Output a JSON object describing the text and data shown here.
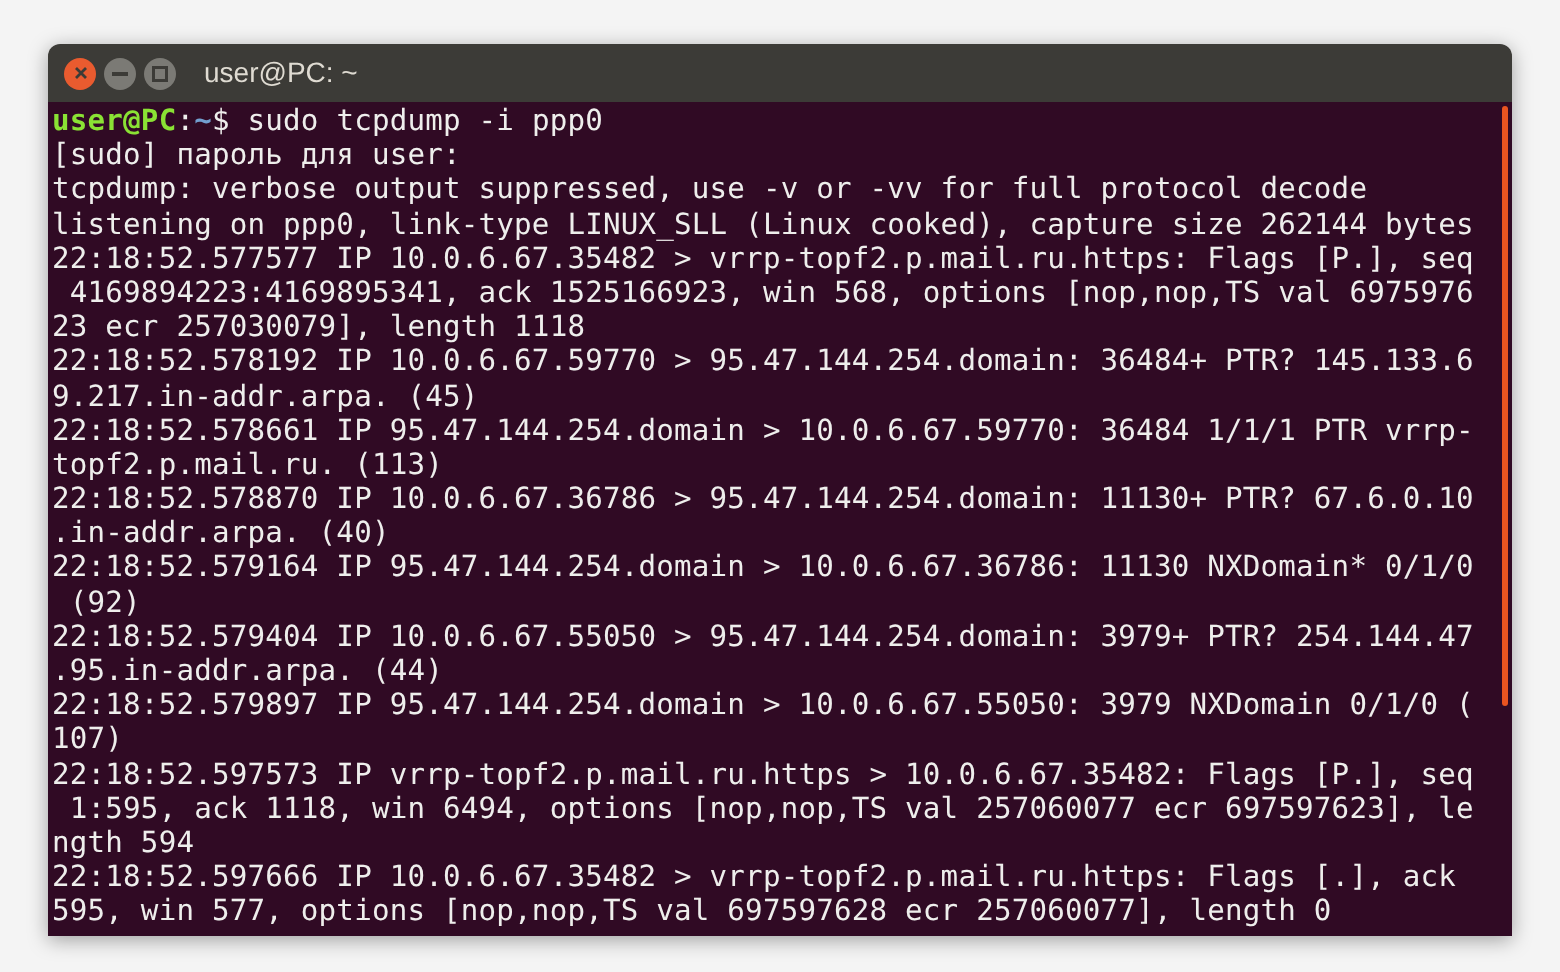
{
  "window": {
    "title": "user@PC: ~",
    "buttons": [
      {
        "kind": "close"
      },
      {
        "kind": "minimize"
      },
      {
        "kind": "maximize"
      }
    ]
  },
  "terminal": {
    "lines": [
      {
        "kind": "prompt",
        "user_host": "user@PC",
        "separator": ":",
        "path": "~",
        "command": "$ sudo tcpdump -i ppp0"
      },
      {
        "kind": "output",
        "text": "[sudo] пароль для user:"
      },
      {
        "kind": "output",
        "text": "tcpdump: verbose output suppressed, use -v or -vv for full protocol decode"
      },
      {
        "kind": "output",
        "text": "listening on ppp0, link-type LINUX_SLL (Linux cooked), capture size 262144 bytes"
      },
      {
        "kind": "output",
        "text": "22:18:52.577577 IP 10.0.6.67.35482 > vrrp-topf2.p.mail.ru.https: Flags [P.], seq"
      },
      {
        "kind": "output",
        "text": " 4169894223:4169895341, ack 1525166923, win 568, options [nop,nop,TS val 6975976"
      },
      {
        "kind": "output",
        "text": "23 ecr 257030079], length 1118"
      },
      {
        "kind": "output",
        "text": "22:18:52.578192 IP 10.0.6.67.59770 > 95.47.144.254.domain: 36484+ PTR? 145.133.6"
      },
      {
        "kind": "output",
        "text": "9.217.in-addr.arpa. (45)"
      },
      {
        "kind": "output",
        "text": "22:18:52.578661 IP 95.47.144.254.domain > 10.0.6.67.59770: 36484 1/1/1 PTR vrrp-"
      },
      {
        "kind": "output",
        "text": "topf2.p.mail.ru. (113)"
      },
      {
        "kind": "output",
        "text": "22:18:52.578870 IP 10.0.6.67.36786 > 95.47.144.254.domain: 11130+ PTR? 67.6.0.10"
      },
      {
        "kind": "output",
        "text": ".in-addr.arpa. (40)"
      },
      {
        "kind": "output",
        "text": "22:18:52.579164 IP 95.47.144.254.domain > 10.0.6.67.36786: 11130 NXDomain* 0/1/0"
      },
      {
        "kind": "output",
        "text": " (92)"
      },
      {
        "kind": "output",
        "text": "22:18:52.579404 IP 10.0.6.67.55050 > 95.47.144.254.domain: 3979+ PTR? 254.144.47"
      },
      {
        "kind": "output",
        "text": ".95.in-addr.arpa. (44)"
      },
      {
        "kind": "output",
        "text": "22:18:52.579897 IP 95.47.144.254.domain > 10.0.6.67.55050: 3979 NXDomain 0/1/0 ("
      },
      {
        "kind": "output",
        "text": "107)"
      },
      {
        "kind": "output",
        "text": "22:18:52.597573 IP vrrp-topf2.p.mail.ru.https > 10.0.6.67.35482: Flags [P.], seq"
      },
      {
        "kind": "output",
        "text": " 1:595, ack 1118, win 6494, options [nop,nop,TS val 257060077 ecr 697597623], le"
      },
      {
        "kind": "output",
        "text": "ngth 594"
      },
      {
        "kind": "output",
        "text": "22:18:52.597666 IP 10.0.6.67.35482 > vrrp-topf2.p.mail.ru.https: Flags [.], ack"
      },
      {
        "kind": "output",
        "text": "595, win 577, options [nop,nop,TS val 697597628 ecr 257060077], length 0"
      }
    ]
  }
}
